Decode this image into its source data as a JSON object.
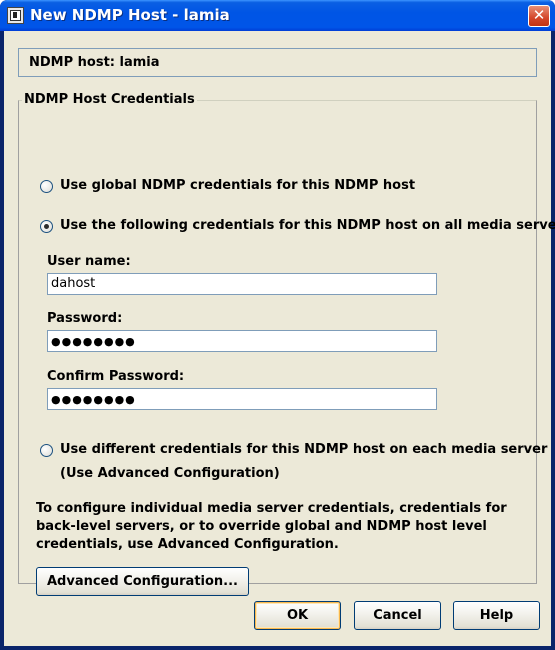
{
  "window": {
    "title": "New NDMP Host - lamia",
    "close_glyph": "✕"
  },
  "host": {
    "label": "NDMP host:",
    "name": "lamia"
  },
  "credentials": {
    "group_title": "NDMP Host Credentials",
    "options": [
      {
        "label": "Use global NDMP credentials for this NDMP host",
        "selected": false
      },
      {
        "label": "Use the following credentials for this NDMP host on all media servers",
        "selected": true
      },
      {
        "label": "Use different credentials for this NDMP host on each media server",
        "selected": false
      }
    ],
    "advanced_hint": "(Use Advanced Configuration)",
    "username_label": "User name:",
    "username_value": "dahost",
    "password_label": "Password:",
    "password_value": "●●●●●●●●",
    "confirm_label": "Confirm Password:",
    "confirm_value": "●●●●●●●●",
    "note": "To configure individual media server credentials, credentials for back-level servers, or to override global and NDMP host level credentials, use Advanced Configuration.",
    "advanced_button": "Advanced Configuration..."
  },
  "buttons": {
    "ok": "OK",
    "cancel": "Cancel",
    "help": "Help"
  }
}
